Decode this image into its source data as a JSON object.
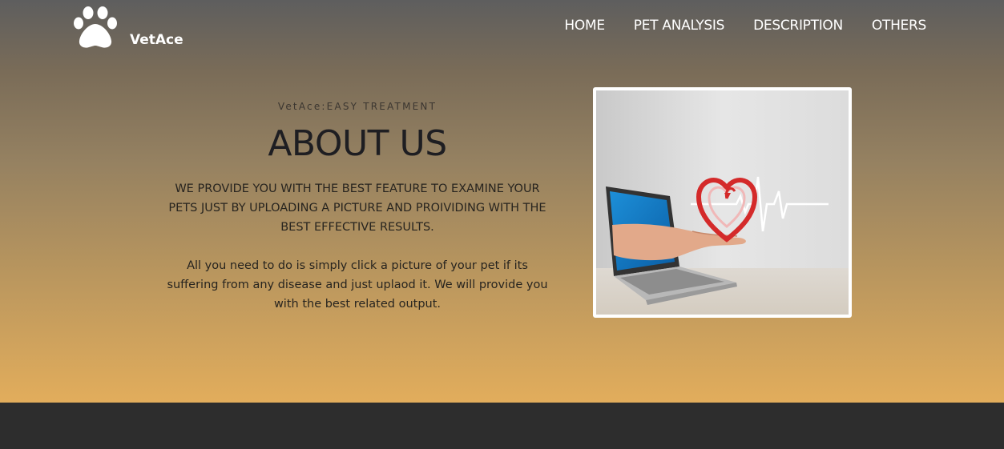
{
  "brand": {
    "name": "VetAce",
    "logo_icon": "paw-icon"
  },
  "nav": {
    "items": [
      {
        "label": "HOME"
      },
      {
        "label": "PET ANALYSIS"
      },
      {
        "label": "DESCRIPTION"
      },
      {
        "label": "OTHERS"
      }
    ]
  },
  "about": {
    "tagline": "VetAce:EASY TREATMENT",
    "heading": "ABOUT US",
    "lead": "WE PROVIDE YOU WITH THE BEST FEATURE TO EXAMINE YOUR PETS JUST BY UPLOADING A PICTURE AND PROIVIDING WITH THE BEST EFFECTIVE RESULTS.",
    "body": "All you need to do is simply click a picture of your pet if its suffering from any disease and just uplaod it. We will provide you with the best related output."
  },
  "colors": {
    "gradient_top": "#5e5e5e",
    "gradient_bottom": "#e2ad5c",
    "footer": "#2d2d2d"
  }
}
